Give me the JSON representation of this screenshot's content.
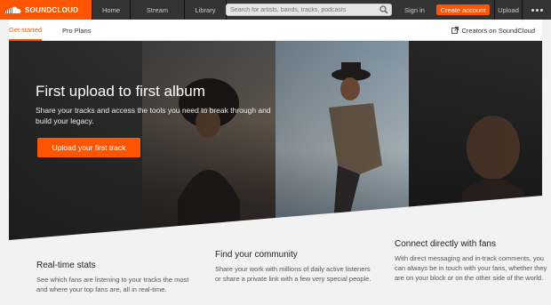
{
  "header": {
    "logo_text": "SOUNDCLOUD",
    "nav": [
      "Home",
      "Stream",
      "Library"
    ],
    "search_placeholder": "Search for artists, bands, tracks, podcasts",
    "signin": "Sign in",
    "create_account": "Create account",
    "upload": "Upload"
  },
  "subnav": {
    "tabs": [
      "Get started",
      "Pro Plans"
    ],
    "creators_link": "Creators on SoundCloud"
  },
  "hero": {
    "title": "First upload to first album",
    "subtitle": "Share your tracks and access the tools you need to break through and build your legacy.",
    "cta": "Upload your first track"
  },
  "features": [
    {
      "title": "Real-time stats",
      "text": "See which fans are listening to your tracks the most and where your top fans are, all in real-time."
    },
    {
      "title": "Find your community",
      "text": "Share your work with millions of daily active listeners or share a private link with a few very special people."
    },
    {
      "title": "Connect directly with fans",
      "text": "With direct messaging and in-track comments, you can always be in touch with your fans, whether they are on your block or on the other side of the world."
    }
  ],
  "colors": {
    "accent": "#ff5500",
    "topbar": "#333333"
  }
}
